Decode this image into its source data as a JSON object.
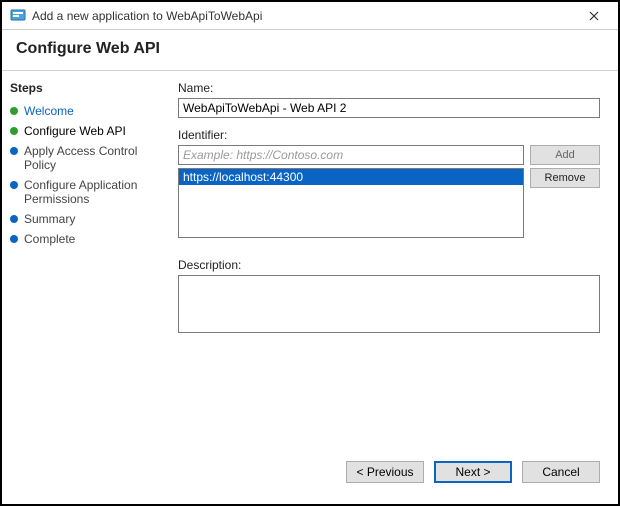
{
  "window": {
    "title": "Add a new application to WebApiToWebApi"
  },
  "header": {
    "title": "Configure Web API"
  },
  "sidebar": {
    "title": "Steps",
    "items": [
      {
        "label": "Welcome",
        "status": "done",
        "link": true
      },
      {
        "label": "Configure Web API",
        "status": "done",
        "current": true
      },
      {
        "label": "Apply Access Control Policy",
        "status": "pending"
      },
      {
        "label": "Configure Application Permissions",
        "status": "pending"
      },
      {
        "label": "Summary",
        "status": "pending"
      },
      {
        "label": "Complete",
        "status": "pending"
      }
    ]
  },
  "main": {
    "name_label": "Name:",
    "name_value": "WebApiToWebApi - Web API 2",
    "identifier_label": "Identifier:",
    "identifier_placeholder": "Example: https://Contoso.com",
    "identifier_value": "",
    "add_label": "Add",
    "remove_label": "Remove",
    "identifier_items": [
      "https://localhost:44300"
    ],
    "description_label": "Description:",
    "description_value": ""
  },
  "footer": {
    "previous": "< Previous",
    "next": "Next >",
    "cancel": "Cancel"
  }
}
